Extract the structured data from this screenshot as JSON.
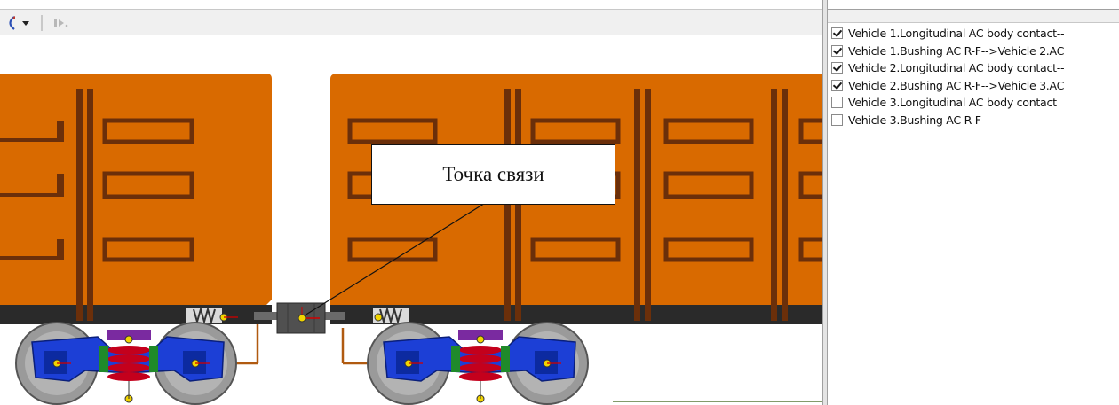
{
  "toolbar": {
    "buttons": [
      {
        "name": "rotate-icon",
        "label": ""
      },
      {
        "name": "dropdown-arrow",
        "label": ""
      },
      {
        "name": "play-step-icon",
        "label": ""
      }
    ]
  },
  "scene": {
    "callout": "Точка связи",
    "colors": {
      "car_body": "#d96a00",
      "car_frame": "#2a2a2a",
      "stake": "#6b2f0a",
      "bogie": "#1c3fd6",
      "spring": "#c4001c",
      "wheel": "#8a8a8a",
      "marker": "#f2d500"
    }
  },
  "object_list": {
    "items": [
      {
        "label": "Vehicle 1.Longitudinal AC body contact--",
        "checked": true
      },
      {
        "label": "Vehicle 1.Bushing AC  R-F-->Vehicle 2.AC",
        "checked": true
      },
      {
        "label": "Vehicle 2.Longitudinal AC body contact--",
        "checked": true
      },
      {
        "label": "Vehicle 2.Bushing AC  R-F-->Vehicle 3.AC",
        "checked": true
      },
      {
        "label": "Vehicle 3.Longitudinal AC body contact",
        "checked": false
      },
      {
        "label": "Vehicle 3.Bushing AC  R-F",
        "checked": false
      }
    ]
  }
}
